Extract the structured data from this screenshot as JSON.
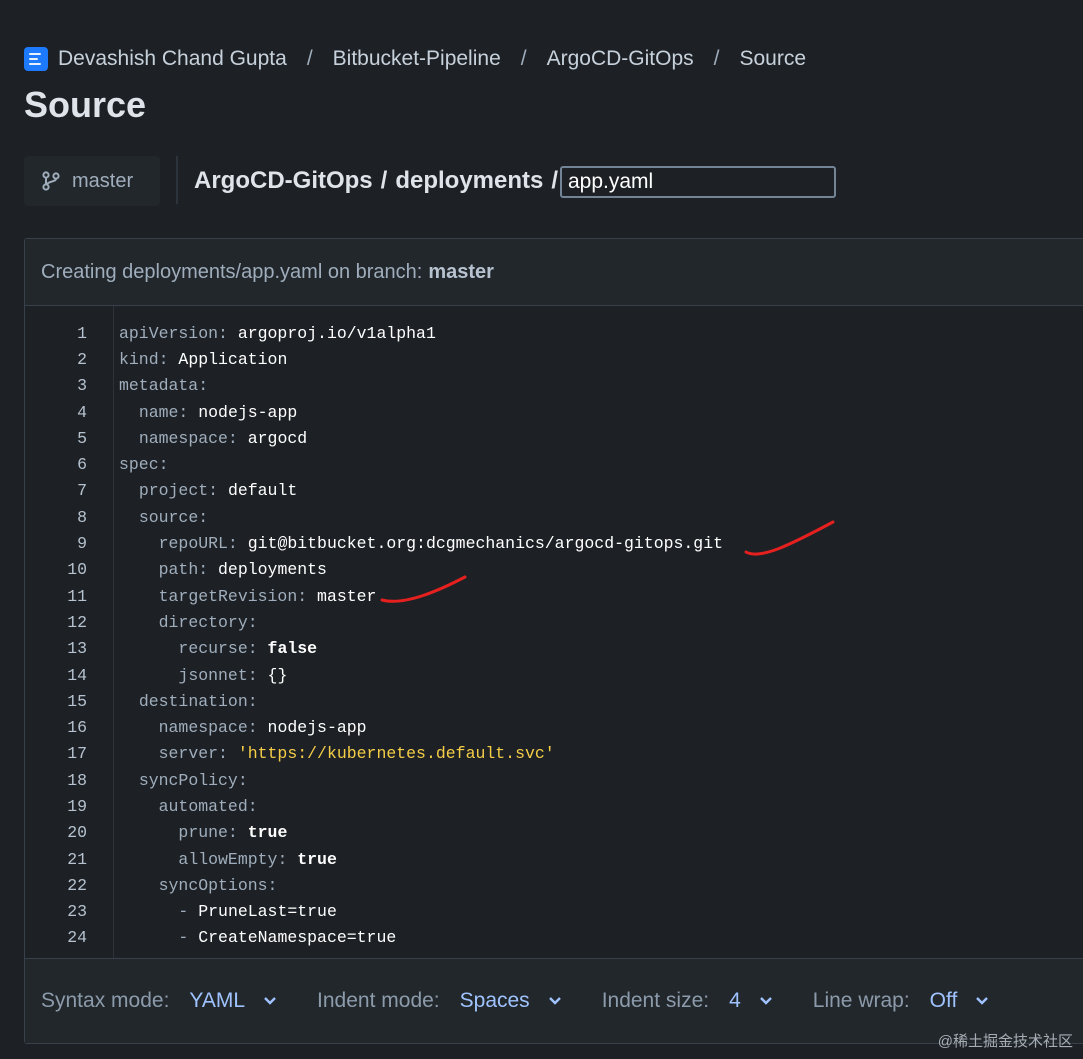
{
  "breadcrumb": {
    "items": [
      "Devashish Chand Gupta",
      "Bitbucket-Pipeline",
      "ArgoCD-GitOps",
      "Source"
    ],
    "separator": "/"
  },
  "page_title": "Source",
  "branch": {
    "label": "master"
  },
  "path": {
    "segments": [
      "ArgoCD-GitOps",
      "deployments"
    ],
    "separator": "/",
    "filename": "app.yaml"
  },
  "panel": {
    "header_prefix": "Creating deployments/app.yaml on branch:",
    "header_branch": "master"
  },
  "code_lines": [
    {
      "n": "1",
      "indent": "",
      "key": "apiVersion:",
      "value": "argoproj.io/v1alpha1",
      "vstyle": "v"
    },
    {
      "n": "2",
      "indent": "",
      "key": "kind:",
      "value": "Application",
      "vstyle": "v"
    },
    {
      "n": "3",
      "indent": "",
      "key": "metadata:",
      "value": "",
      "vstyle": "v"
    },
    {
      "n": "4",
      "indent": "  ",
      "key": "name:",
      "value": "nodejs-app",
      "vstyle": "v"
    },
    {
      "n": "5",
      "indent": "  ",
      "key": "namespace:",
      "value": "argocd",
      "vstyle": "v"
    },
    {
      "n": "6",
      "indent": "",
      "key": "spec:",
      "value": "",
      "vstyle": "v"
    },
    {
      "n": "7",
      "indent": "  ",
      "key": "project:",
      "value": "default",
      "vstyle": "v"
    },
    {
      "n": "8",
      "indent": "  ",
      "key": "source:",
      "value": "",
      "vstyle": "v"
    },
    {
      "n": "9",
      "indent": "    ",
      "key": "repoURL:",
      "value": "git@bitbucket.org:dcgmechanics/argocd-gitops.git",
      "vstyle": "v"
    },
    {
      "n": "10",
      "indent": "    ",
      "key": "path:",
      "value": "deployments",
      "vstyle": "v"
    },
    {
      "n": "11",
      "indent": "    ",
      "key": "targetRevision:",
      "value": "master",
      "vstyle": "v"
    },
    {
      "n": "12",
      "indent": "    ",
      "key": "directory:",
      "value": "",
      "vstyle": "v"
    },
    {
      "n": "13",
      "indent": "      ",
      "key": "recurse:",
      "value": "false",
      "vstyle": "vb"
    },
    {
      "n": "14",
      "indent": "      ",
      "key": "jsonnet:",
      "value": "{}",
      "vstyle": "v"
    },
    {
      "n": "15",
      "indent": "  ",
      "key": "destination:",
      "value": "",
      "vstyle": "v"
    },
    {
      "n": "16",
      "indent": "    ",
      "key": "namespace:",
      "value": "nodejs-app",
      "vstyle": "v"
    },
    {
      "n": "17",
      "indent": "    ",
      "key": "server:",
      "value": "'https://kubernetes.default.svc'",
      "vstyle": "s"
    },
    {
      "n": "18",
      "indent": "  ",
      "key": "syncPolicy:",
      "value": "",
      "vstyle": "v"
    },
    {
      "n": "19",
      "indent": "    ",
      "key": "automated:",
      "value": "",
      "vstyle": "v"
    },
    {
      "n": "20",
      "indent": "      ",
      "key": "prune:",
      "value": "true",
      "vstyle": "vb"
    },
    {
      "n": "21",
      "indent": "      ",
      "key": "allowEmpty:",
      "value": "true",
      "vstyle": "vb"
    },
    {
      "n": "22",
      "indent": "    ",
      "key": "syncOptions:",
      "value": "",
      "vstyle": "v"
    },
    {
      "n": "23",
      "indent": "      ",
      "key": "- ",
      "value": "PruneLast=true",
      "vstyle": "v"
    },
    {
      "n": "24",
      "indent": "      ",
      "key": "- ",
      "value": "CreateNamespace=true",
      "vstyle": "v"
    }
  ],
  "footer": {
    "syntax_label": "Syntax mode:",
    "syntax_value": "YAML",
    "indent_label": "Indent mode:",
    "indent_value": "Spaces",
    "size_label": "Indent size:",
    "size_value": "4",
    "wrap_label": "Line wrap:",
    "wrap_value": "Off"
  },
  "watermark": "@稀土掘金技术社区",
  "colors": {
    "background": "#1d2125",
    "accent": "#1d7afc",
    "annotation": "#e5201f",
    "string": "#f5cd47"
  },
  "icons": [
    "repo-icon",
    "branch-icon",
    "chevron-down-icon"
  ]
}
